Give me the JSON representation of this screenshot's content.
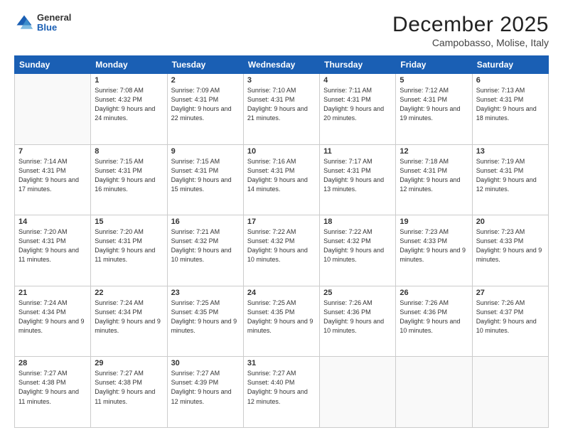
{
  "header": {
    "logo": {
      "general": "General",
      "blue": "Blue"
    },
    "title": "December 2025",
    "subtitle": "Campobasso, Molise, Italy"
  },
  "calendar": {
    "days_of_week": [
      "Sunday",
      "Monday",
      "Tuesday",
      "Wednesday",
      "Thursday",
      "Friday",
      "Saturday"
    ],
    "weeks": [
      [
        {
          "day": "",
          "sunrise": "",
          "sunset": "",
          "daylight": ""
        },
        {
          "day": "1",
          "sunrise": "Sunrise: 7:08 AM",
          "sunset": "Sunset: 4:32 PM",
          "daylight": "Daylight: 9 hours and 24 minutes."
        },
        {
          "day": "2",
          "sunrise": "Sunrise: 7:09 AM",
          "sunset": "Sunset: 4:31 PM",
          "daylight": "Daylight: 9 hours and 22 minutes."
        },
        {
          "day": "3",
          "sunrise": "Sunrise: 7:10 AM",
          "sunset": "Sunset: 4:31 PM",
          "daylight": "Daylight: 9 hours and 21 minutes."
        },
        {
          "day": "4",
          "sunrise": "Sunrise: 7:11 AM",
          "sunset": "Sunset: 4:31 PM",
          "daylight": "Daylight: 9 hours and 20 minutes."
        },
        {
          "day": "5",
          "sunrise": "Sunrise: 7:12 AM",
          "sunset": "Sunset: 4:31 PM",
          "daylight": "Daylight: 9 hours and 19 minutes."
        },
        {
          "day": "6",
          "sunrise": "Sunrise: 7:13 AM",
          "sunset": "Sunset: 4:31 PM",
          "daylight": "Daylight: 9 hours and 18 minutes."
        }
      ],
      [
        {
          "day": "7",
          "sunrise": "Sunrise: 7:14 AM",
          "sunset": "Sunset: 4:31 PM",
          "daylight": "Daylight: 9 hours and 17 minutes."
        },
        {
          "day": "8",
          "sunrise": "Sunrise: 7:15 AM",
          "sunset": "Sunset: 4:31 PM",
          "daylight": "Daylight: 9 hours and 16 minutes."
        },
        {
          "day": "9",
          "sunrise": "Sunrise: 7:15 AM",
          "sunset": "Sunset: 4:31 PM",
          "daylight": "Daylight: 9 hours and 15 minutes."
        },
        {
          "day": "10",
          "sunrise": "Sunrise: 7:16 AM",
          "sunset": "Sunset: 4:31 PM",
          "daylight": "Daylight: 9 hours and 14 minutes."
        },
        {
          "day": "11",
          "sunrise": "Sunrise: 7:17 AM",
          "sunset": "Sunset: 4:31 PM",
          "daylight": "Daylight: 9 hours and 13 minutes."
        },
        {
          "day": "12",
          "sunrise": "Sunrise: 7:18 AM",
          "sunset": "Sunset: 4:31 PM",
          "daylight": "Daylight: 9 hours and 12 minutes."
        },
        {
          "day": "13",
          "sunrise": "Sunrise: 7:19 AM",
          "sunset": "Sunset: 4:31 PM",
          "daylight": "Daylight: 9 hours and 12 minutes."
        }
      ],
      [
        {
          "day": "14",
          "sunrise": "Sunrise: 7:20 AM",
          "sunset": "Sunset: 4:31 PM",
          "daylight": "Daylight: 9 hours and 11 minutes."
        },
        {
          "day": "15",
          "sunrise": "Sunrise: 7:20 AM",
          "sunset": "Sunset: 4:31 PM",
          "daylight": "Daylight: 9 hours and 11 minutes."
        },
        {
          "day": "16",
          "sunrise": "Sunrise: 7:21 AM",
          "sunset": "Sunset: 4:32 PM",
          "daylight": "Daylight: 9 hours and 10 minutes."
        },
        {
          "day": "17",
          "sunrise": "Sunrise: 7:22 AM",
          "sunset": "Sunset: 4:32 PM",
          "daylight": "Daylight: 9 hours and 10 minutes."
        },
        {
          "day": "18",
          "sunrise": "Sunrise: 7:22 AM",
          "sunset": "Sunset: 4:32 PM",
          "daylight": "Daylight: 9 hours and 10 minutes."
        },
        {
          "day": "19",
          "sunrise": "Sunrise: 7:23 AM",
          "sunset": "Sunset: 4:33 PM",
          "daylight": "Daylight: 9 hours and 9 minutes."
        },
        {
          "day": "20",
          "sunrise": "Sunrise: 7:23 AM",
          "sunset": "Sunset: 4:33 PM",
          "daylight": "Daylight: 9 hours and 9 minutes."
        }
      ],
      [
        {
          "day": "21",
          "sunrise": "Sunrise: 7:24 AM",
          "sunset": "Sunset: 4:34 PM",
          "daylight": "Daylight: 9 hours and 9 minutes."
        },
        {
          "day": "22",
          "sunrise": "Sunrise: 7:24 AM",
          "sunset": "Sunset: 4:34 PM",
          "daylight": "Daylight: 9 hours and 9 minutes."
        },
        {
          "day": "23",
          "sunrise": "Sunrise: 7:25 AM",
          "sunset": "Sunset: 4:35 PM",
          "daylight": "Daylight: 9 hours and 9 minutes."
        },
        {
          "day": "24",
          "sunrise": "Sunrise: 7:25 AM",
          "sunset": "Sunset: 4:35 PM",
          "daylight": "Daylight: 9 hours and 9 minutes."
        },
        {
          "day": "25",
          "sunrise": "Sunrise: 7:26 AM",
          "sunset": "Sunset: 4:36 PM",
          "daylight": "Daylight: 9 hours and 10 minutes."
        },
        {
          "day": "26",
          "sunrise": "Sunrise: 7:26 AM",
          "sunset": "Sunset: 4:36 PM",
          "daylight": "Daylight: 9 hours and 10 minutes."
        },
        {
          "day": "27",
          "sunrise": "Sunrise: 7:26 AM",
          "sunset": "Sunset: 4:37 PM",
          "daylight": "Daylight: 9 hours and 10 minutes."
        }
      ],
      [
        {
          "day": "28",
          "sunrise": "Sunrise: 7:27 AM",
          "sunset": "Sunset: 4:38 PM",
          "daylight": "Daylight: 9 hours and 11 minutes."
        },
        {
          "day": "29",
          "sunrise": "Sunrise: 7:27 AM",
          "sunset": "Sunset: 4:38 PM",
          "daylight": "Daylight: 9 hours and 11 minutes."
        },
        {
          "day": "30",
          "sunrise": "Sunrise: 7:27 AM",
          "sunset": "Sunset: 4:39 PM",
          "daylight": "Daylight: 9 hours and 12 minutes."
        },
        {
          "day": "31",
          "sunrise": "Sunrise: 7:27 AM",
          "sunset": "Sunset: 4:40 PM",
          "daylight": "Daylight: 9 hours and 12 minutes."
        },
        {
          "day": "",
          "sunrise": "",
          "sunset": "",
          "daylight": ""
        },
        {
          "day": "",
          "sunrise": "",
          "sunset": "",
          "daylight": ""
        },
        {
          "day": "",
          "sunrise": "",
          "sunset": "",
          "daylight": ""
        }
      ]
    ]
  }
}
